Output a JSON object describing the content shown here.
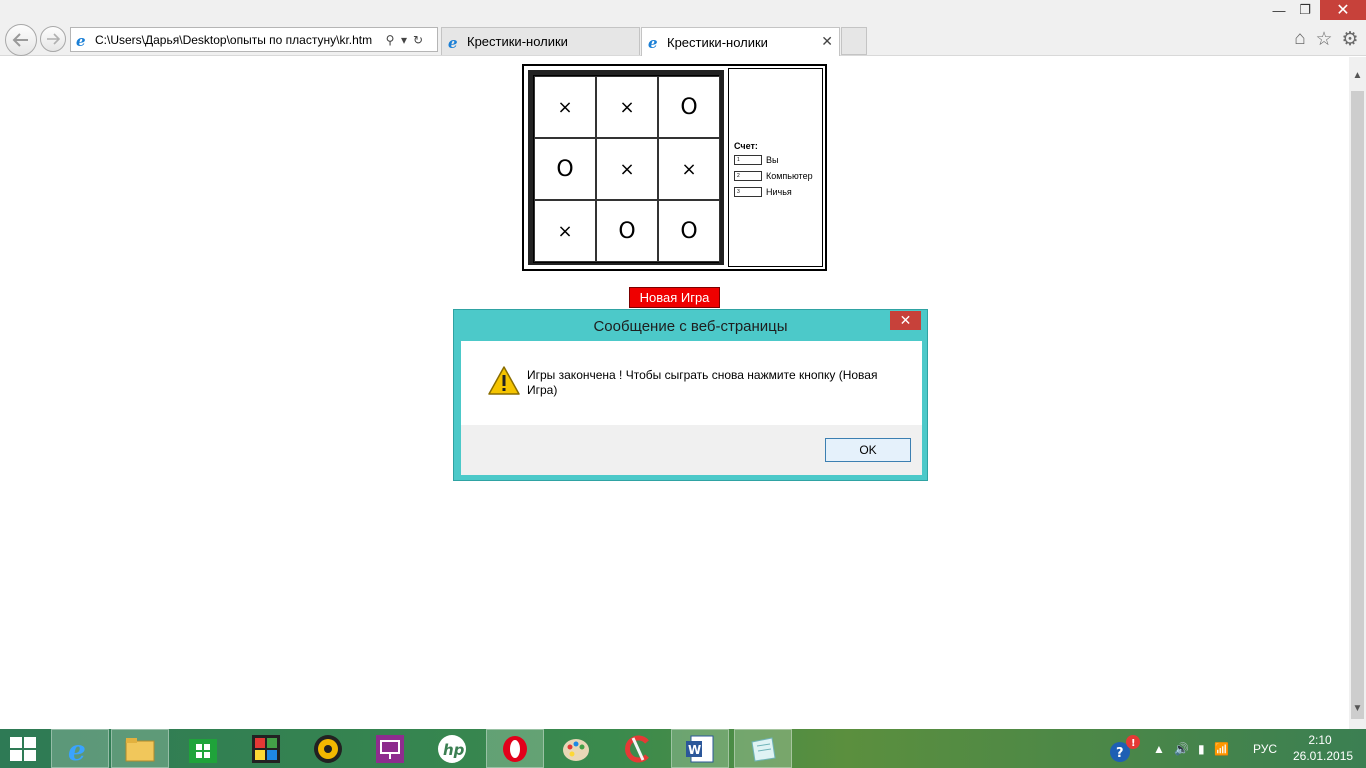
{
  "browser": {
    "address": "C:\\Users\\Дарья\\Desktop\\опыты по пластуну\\kr.htm",
    "tabs": [
      {
        "label": "Крестики-нолики",
        "active": false
      },
      {
        "label": "Крестики-нолики",
        "active": true
      }
    ],
    "window_controls": {
      "minimize": "—",
      "maximize": "❐",
      "close": "✕"
    },
    "toolbar_icons": [
      "home-icon",
      "star-icon",
      "gear-icon"
    ]
  },
  "game": {
    "board": [
      [
        "×",
        "×",
        "O"
      ],
      [
        "O",
        "×",
        "×"
      ],
      [
        "×",
        "O",
        "O"
      ]
    ],
    "score": {
      "title": "Счет:",
      "rows": [
        {
          "value": "1",
          "label": "Вы"
        },
        {
          "value": "2",
          "label": "Компьютер"
        },
        {
          "value": "3",
          "label": "Ничья"
        }
      ]
    },
    "new_game_label": "Новая Игра"
  },
  "dialog": {
    "title": "Сообщение с веб-страницы",
    "message": "Игры закончена ! Чтобы сыграть снова нажмите кнопку (Новая Игра)",
    "ok_label": "OK",
    "close": "✕"
  },
  "taskbar": {
    "apps": [
      "internet-explorer",
      "file-explorer",
      "store",
      "puzzle-app",
      "media-player",
      "presentation-app",
      "hp-app",
      "opera",
      "paint",
      "ccleaner",
      "word",
      "notepad-app"
    ],
    "language": "РУС",
    "time": "2:10",
    "date": "26.01.2015"
  },
  "colors": {
    "accent": "#4cc9c9",
    "new_game_bg": "#ef0000",
    "taskbar": "#3a8a4d",
    "close_red": "#c7413a"
  }
}
